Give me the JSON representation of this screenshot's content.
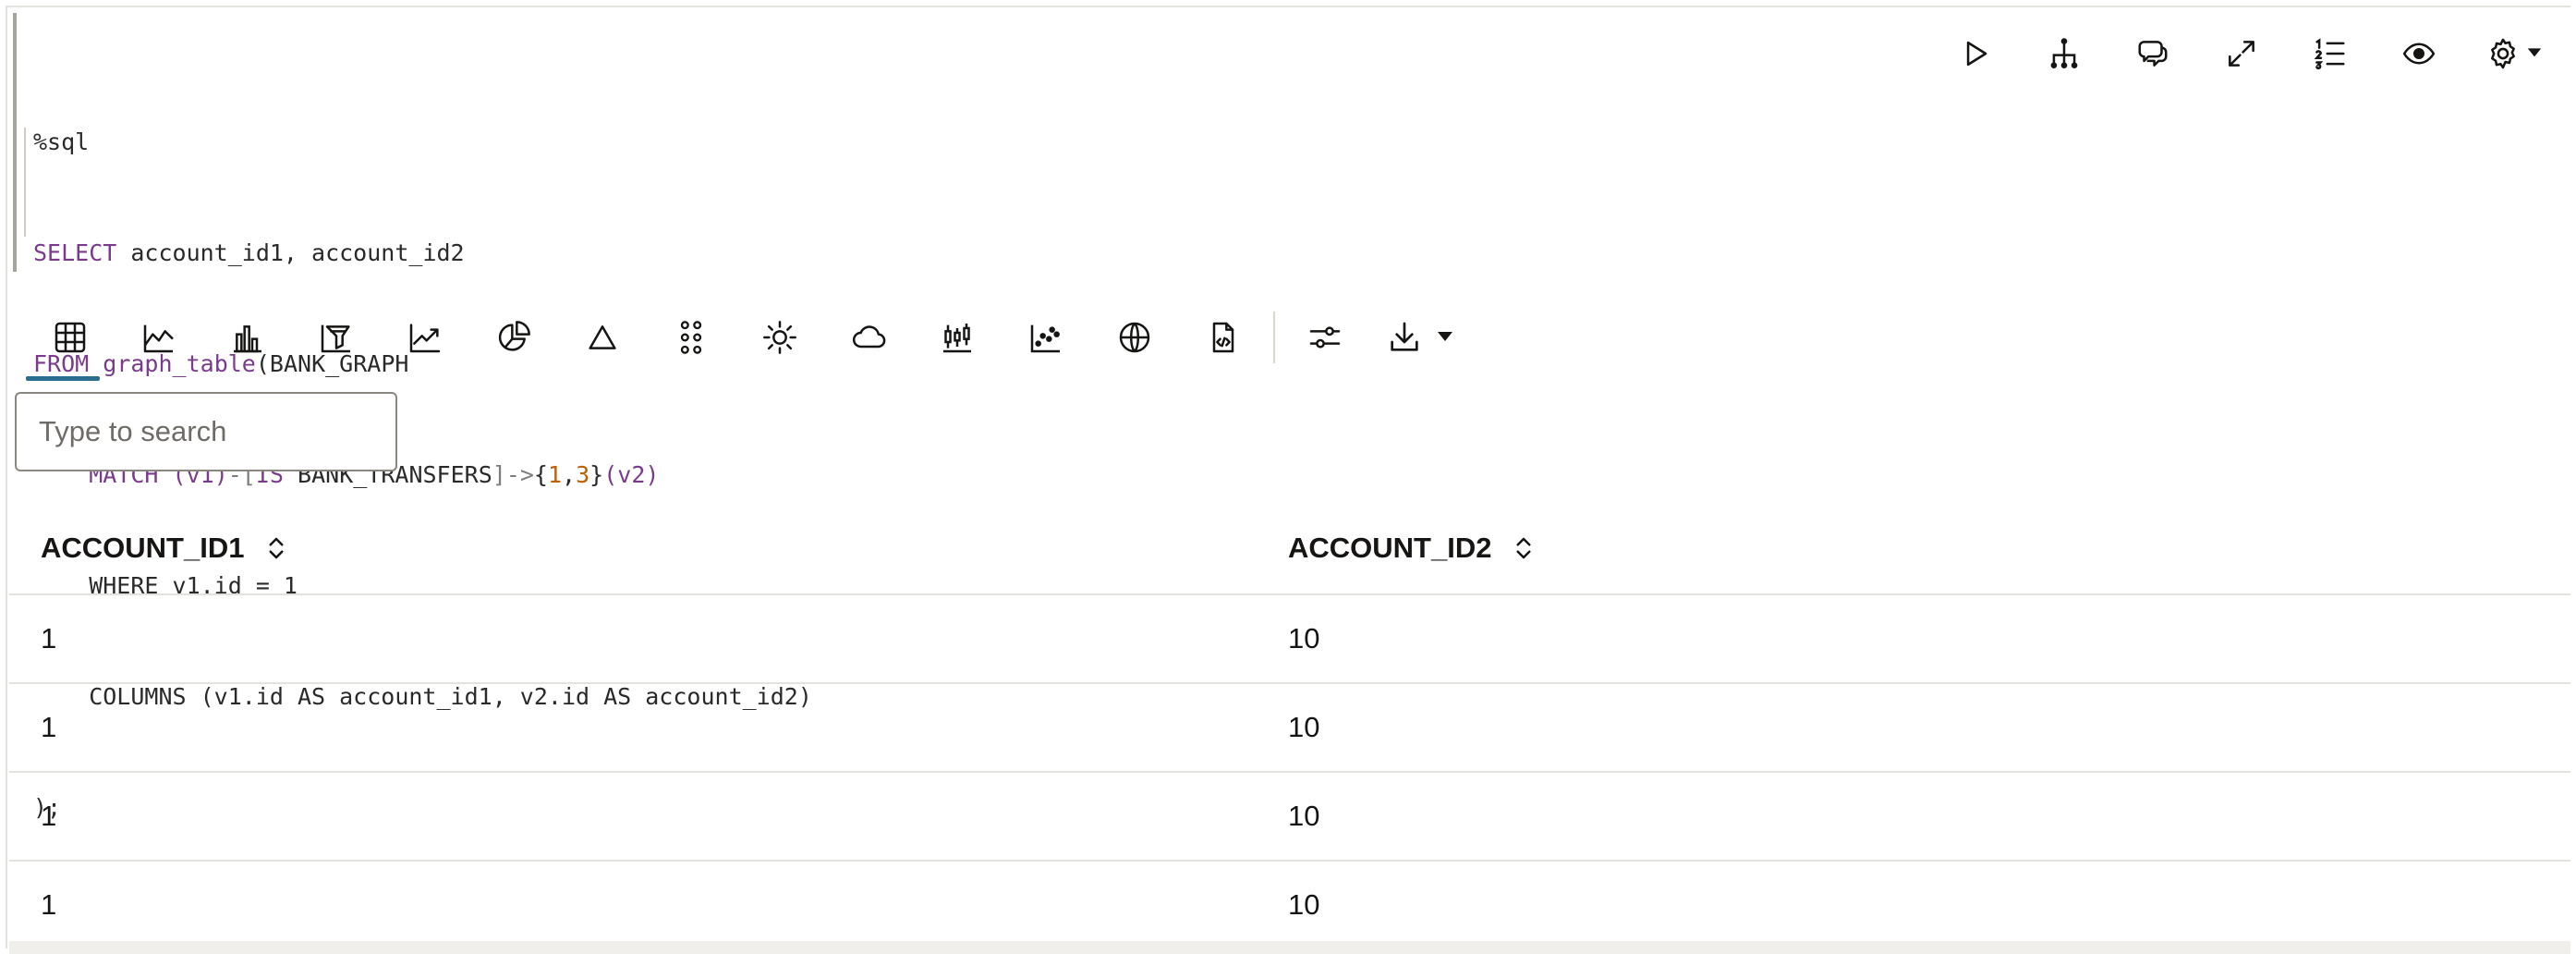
{
  "editor": {
    "lines": [
      "%sql",
      "SELECT account_id1, account_id2",
      "FROM graph_table(BANK_GRAPH",
      "    MATCH (v1)-[IS BANK_TRANSFERS]->{1,3}(v2)",
      "    WHERE v1.id = 1",
      "    COLUMNS (v1.id AS account_id1, v2.id AS account_id2)",
      ");"
    ]
  },
  "cell_actions": [
    {
      "name": "run-icon",
      "label": "Run"
    },
    {
      "name": "dependency-tree-icon",
      "label": "Dependencies"
    },
    {
      "name": "comment-icon",
      "label": "Comments"
    },
    {
      "name": "expand-icon",
      "label": "Expand"
    },
    {
      "name": "line-numbers-icon",
      "label": "Line numbers"
    },
    {
      "name": "visibility-icon",
      "label": "Show/Hide"
    },
    {
      "name": "settings-gear-icon",
      "label": "Settings"
    }
  ],
  "viz_toolbar": {
    "active": "table-view-icon",
    "items": [
      "table-view-icon",
      "area-chart-icon",
      "bar-chart-icon",
      "funnel-chart-icon",
      "line-chart-icon",
      "pie-chart-icon",
      "pyramid-chart-icon",
      "dot-matrix-icon",
      "sunburst-icon",
      "tag-cloud-icon",
      "boxplot-icon",
      "scatter-plot-icon",
      "map-globe-icon",
      "custom-viz-icon",
      "settings-sliders-icon",
      "download-icon"
    ]
  },
  "search": {
    "placeholder": "Type to search",
    "value": ""
  },
  "table": {
    "columns": [
      "ACCOUNT_ID1",
      "ACCOUNT_ID2"
    ],
    "rows": [
      [
        "1",
        "10"
      ],
      [
        "1",
        "10"
      ],
      [
        "1",
        "10"
      ],
      [
        "1",
        "10"
      ]
    ]
  },
  "colors": {
    "accent": "#2b6d8f",
    "keyword": "#7a3b8d",
    "number": "#c06000",
    "border": "#e4e2de"
  }
}
